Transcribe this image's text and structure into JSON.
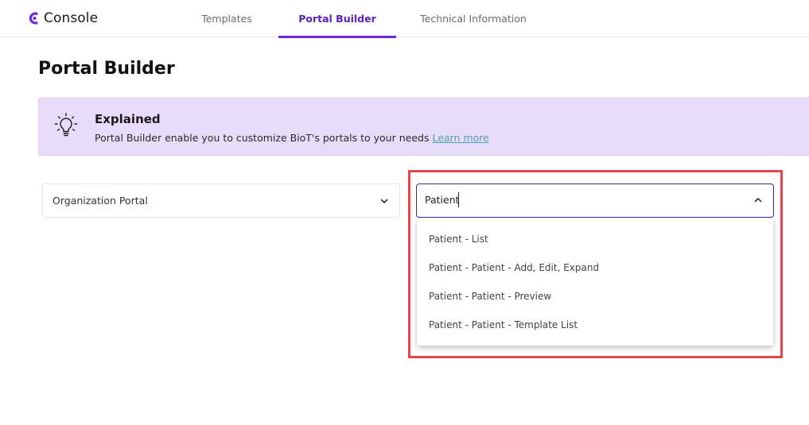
{
  "app": {
    "name": "Console",
    "brand_color": "#6d28d9"
  },
  "tabs": [
    {
      "label": "Templates"
    },
    {
      "label": "Portal Builder",
      "active": true
    },
    {
      "label": "Technical Information"
    }
  ],
  "page": {
    "title": "Portal Builder"
  },
  "banner": {
    "icon": "lightbulb-icon",
    "title": "Explained",
    "text": "Portal Builder enable you to customize BioT's portals to your needs",
    "link": "Learn more"
  },
  "portal_select": {
    "value": "Organization Portal",
    "icon": "chevron-down-icon"
  },
  "view_select": {
    "value": "Patient",
    "icon": "chevron-up-icon",
    "options": [
      "Patient - List",
      "Patient - Patient - Add, Edit, Expand",
      "Patient - Patient - Preview",
      "Patient - Patient - Template List"
    ]
  },
  "colors": {
    "highlight": "#e0484d",
    "banner_bg": "#e9dcfa",
    "link": "#4aa3a8"
  }
}
